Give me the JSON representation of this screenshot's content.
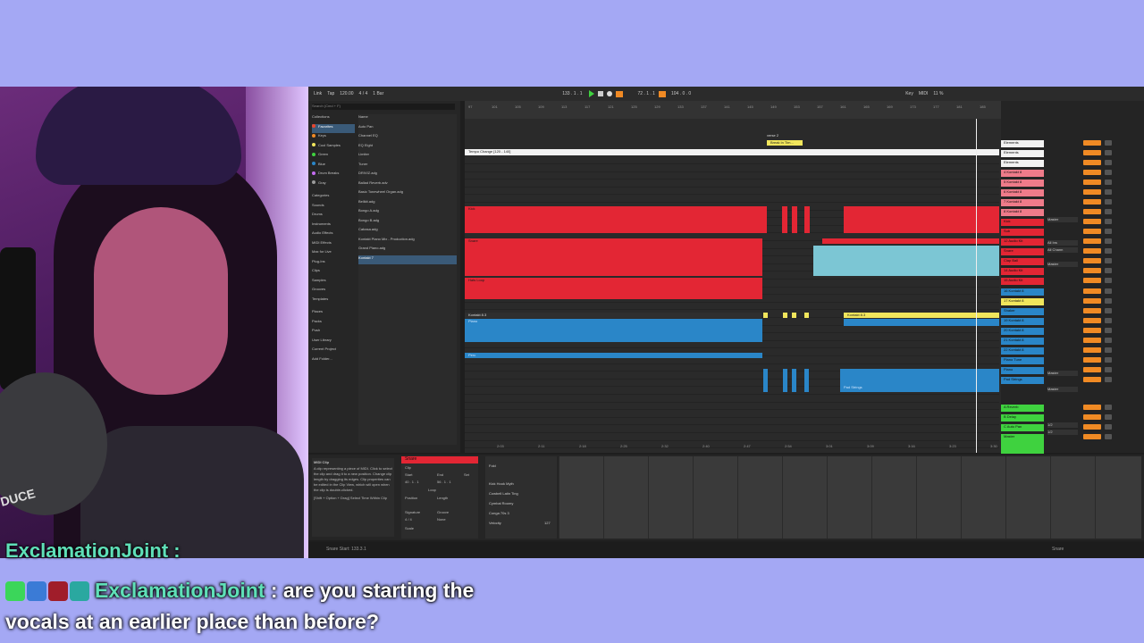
{
  "daw": {
    "topbar": {
      "link": "Link",
      "tap": "Tap",
      "tempo": "120.00",
      "signature": "4 / 4",
      "quantize": "1 Bar",
      "position": "133 . 1 . 1",
      "loop_start": "72 . 1 . 1",
      "loop_length": "104 . 0 . 0",
      "key": "Key",
      "midi": "MIDI",
      "cpu": "11 %"
    },
    "browser": {
      "search_placeholder": "Search (Cmd + F)",
      "collections_header": "Collections",
      "collections": [
        {
          "label": "Favorites",
          "color": "#e8452c"
        },
        {
          "label": "Keys",
          "color": "#f08a24"
        },
        {
          "label": "Cool Samples",
          "color": "#f1e65c"
        },
        {
          "label": "Green",
          "color": "#3fd23f"
        },
        {
          "label": "Blue",
          "color": "#2a86c8"
        },
        {
          "label": "Drum Breaks",
          "color": "#c46cf0"
        },
        {
          "label": "Gray",
          "color": "#9a9a9a"
        }
      ],
      "categories_header": "Categories",
      "categories": [
        "Sounds",
        "Drums",
        "Instruments",
        "Audio Effects",
        "MIDI Effects",
        "Max for Live",
        "Plug-Ins",
        "Clips",
        "Samples",
        "Grooves",
        "Templates"
      ],
      "places_header": "Places",
      "places": [
        "Packs",
        "Push",
        "User Library",
        "Current Project",
        "Add Folder..."
      ],
      "name_header": "Name",
      "files": [
        "Auto Pan",
        "Channel EQ",
        "EQ Eight",
        "Limiter",
        "Tuner",
        "DRIVIZ.adg",
        "Ballad Reverb.adv",
        "Basic Tonewheel Organ.adg",
        "Bellkit.adg",
        "Bongo A.adg",
        "Bongo B.adg",
        "Cabasa.adg",
        "Kontakt Piano Mix - Production.adg",
        "Grand Piano.adg",
        "Kontakt 7"
      ]
    },
    "arrangement": {
      "ruler": [
        "97",
        "101",
        "105",
        "109",
        "113",
        "117",
        "121",
        "125",
        "129",
        "133",
        "137",
        "141",
        "145",
        "149",
        "153",
        "157",
        "161",
        "165",
        "169",
        "173",
        "177",
        "181",
        "185"
      ],
      "locator": "verse 2",
      "locator_clip": "Break In Tim...",
      "tempo_lane": "Tempo Change [120 - 140]",
      "clips": {
        "kontakt": "Kontakt 8.3",
        "kontakt_right": "Kontakt 8.3",
        "piano": "Piano",
        "pad": "Pad Strings",
        "snare": "Snare",
        "kick": "Kick",
        "hats": "Hats Loop",
        "perc": "Perc"
      },
      "time_labels": [
        "2:03",
        "2:11",
        "2:18",
        "2:25",
        "2:32",
        "2:40",
        "2:47",
        "2:54",
        "3:01",
        "3:09",
        "3:16",
        "3:23",
        "3:30"
      ]
    },
    "mixer": {
      "tracks": [
        {
          "label": "Elements",
          "color": "#f2f2f2"
        },
        {
          "label": "Elements",
          "color": "#f2f2f2"
        },
        {
          "label": "Elements",
          "color": "#f2f2f2"
        },
        {
          "label": "4 Kontakt 8",
          "color": "#ef7b8a"
        },
        {
          "label": "5 Kontakt 8",
          "color": "#ef7b8a"
        },
        {
          "label": "6 Kontakt 8",
          "color": "#ef7b8a"
        },
        {
          "label": "7 Kontakt 8",
          "color": "#ef7b8a"
        },
        {
          "label": "8 Kontakt 8",
          "color": "#ef7b8a"
        },
        {
          "label": "Kick",
          "color": "#e32634"
        },
        {
          "label": "Sub",
          "color": "#e32634"
        },
        {
          "label": "12 Audio Kit",
          "color": "#e32634"
        },
        {
          "label": "Snare",
          "color": "#e32634"
        },
        {
          "label": "Clap Ball",
          "color": "#e32634"
        },
        {
          "label": "14 Audio Kit",
          "color": "#e32634"
        },
        {
          "label": "15 Audio Kit",
          "color": "#e32634"
        },
        {
          "label": "16 Kontakt 8",
          "color": "#2a86c8"
        },
        {
          "label": "17 Kontakt 8",
          "color": "#f1e65c"
        },
        {
          "label": "Shaker",
          "color": "#2a86c8"
        },
        {
          "label": "19 Kontakt 8",
          "color": "#2a86c8"
        },
        {
          "label": "20 Kontakt 8",
          "color": "#2a86c8"
        },
        {
          "label": "21 Kontakt 8",
          "color": "#2a86c8"
        },
        {
          "label": "22 Kontakt 8",
          "color": "#2a86c8"
        },
        {
          "label": "Piano Tune",
          "color": "#2a86c8"
        },
        {
          "label": "Piano",
          "color": "#2a86c8"
        },
        {
          "label": "Pad Strings",
          "color": "#2a86c8"
        },
        {
          "label": "A Reverb",
          "color": "#3fd23f"
        },
        {
          "label": "B Delay",
          "color": "#3fd23f"
        },
        {
          "label": "C Auto Pan",
          "color": "#3fd23f"
        },
        {
          "label": "Master",
          "color": "#3fd23f"
        }
      ],
      "routing": [
        "Master",
        "All Ins",
        "All Chann",
        "Master",
        "Master",
        "Master",
        "1/2",
        "1/2"
      ]
    },
    "detail": {
      "info_title": "MIDI Clip",
      "info_text": "A clip representing a piece of MIDI. Click to select the clip and drag it to a new position. Change clip length by dragging its edges. Clip properties can be edited in the Clip View, which will open when the clip is double-clicked.",
      "info_shortcut": "[Shift + Option + Drag] Select Time Within Clip",
      "clip_name": "Snare",
      "clip_label": "Clip",
      "start_label": "Start",
      "end_label": "End",
      "set_label": "Set",
      "start_value": "40 . 1 . 1",
      "end_value": "56 . 1 . 1",
      "loop_label": "Loop",
      "position_label": "Position",
      "length_label": "Length",
      "signature_label": "Signature",
      "groove_label": "Groove",
      "sig_values": "4 / 4",
      "groove_value": "None",
      "scale_label": "Scale",
      "drum_header": "Fold",
      "drum_lanes": [
        "Kick Hook Myth",
        "Cowbell Latin Ting",
        "Cymbal Roomy",
        "Conga 70s 3"
      ],
      "velocity_label": "Velocity",
      "velocity_value": "127"
    },
    "status": {
      "text": "Snare Start: 133.3.1",
      "right": "Snare"
    }
  },
  "chat": {
    "partial_line": "ExclamationJoint :",
    "username": "ExclamationJoint",
    "separator": " : ",
    "message_line1": "are you starting the",
    "message_line2": "vocals at an earlier place than before?",
    "badges": [
      {
        "name": "k-badge",
        "color": "#3bd65a"
      },
      {
        "name": "arrow-badge",
        "color": "#3b7bd6"
      },
      {
        "name": "circle-badge",
        "color": "#a01d2a"
      },
      {
        "name": "bg-badge",
        "color": "#2aa8a0"
      }
    ]
  },
  "webcam": {
    "mic_brand": "DUCE"
  }
}
